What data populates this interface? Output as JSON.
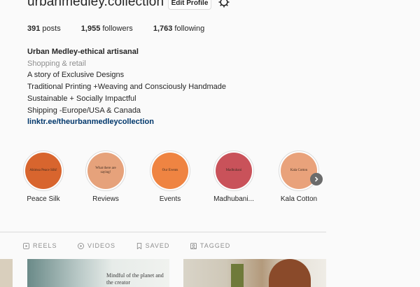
{
  "profile": {
    "username": "urbanmedley.collection",
    "edit_label": "Edit Profile",
    "posts_count": "391",
    "posts_label": " posts",
    "followers_count": "1,955",
    "followers_label": " followers",
    "following_count": "1,763",
    "following_label": " following"
  },
  "bio": {
    "name": "Urban Medley-ethical artisanal",
    "category": "Shopping & retail",
    "lines": [
      "A story of Exclusive Designs",
      "Traditional Printing +Weaving and Consciously Handmade",
      "Sustainable + Socially Impactful",
      "Shipping -Europe/USA & Canada"
    ],
    "link": "linktr.ee/theurbanmedleycollection"
  },
  "highlights": [
    {
      "label": "Peace Silk",
      "cover_text": "Ahimsa Peace Silk!",
      "color": "#d8652e"
    },
    {
      "label": "Reviews",
      "cover_text": "What there are saying!",
      "color": "#e6a27b"
    },
    {
      "label": "Events",
      "cover_text": "Our Events",
      "color": "#ef8442"
    },
    {
      "label": "Madhubani...",
      "cover_text": "Madhubani",
      "color": "#c9525a"
    },
    {
      "label": "Kala Cotton",
      "cover_text": "Kala Cotton",
      "color": "#e9a27b"
    }
  ],
  "tabs": [
    {
      "label": "REELS",
      "icon": "reels-icon"
    },
    {
      "label": "VIDEOS",
      "icon": "video-icon"
    },
    {
      "label": "SAVED",
      "icon": "bookmark-icon"
    },
    {
      "label": "TAGGED",
      "icon": "tag-icon"
    }
  ],
  "posts": [
    {
      "caption": "Mindful of the planet and the creator"
    }
  ]
}
